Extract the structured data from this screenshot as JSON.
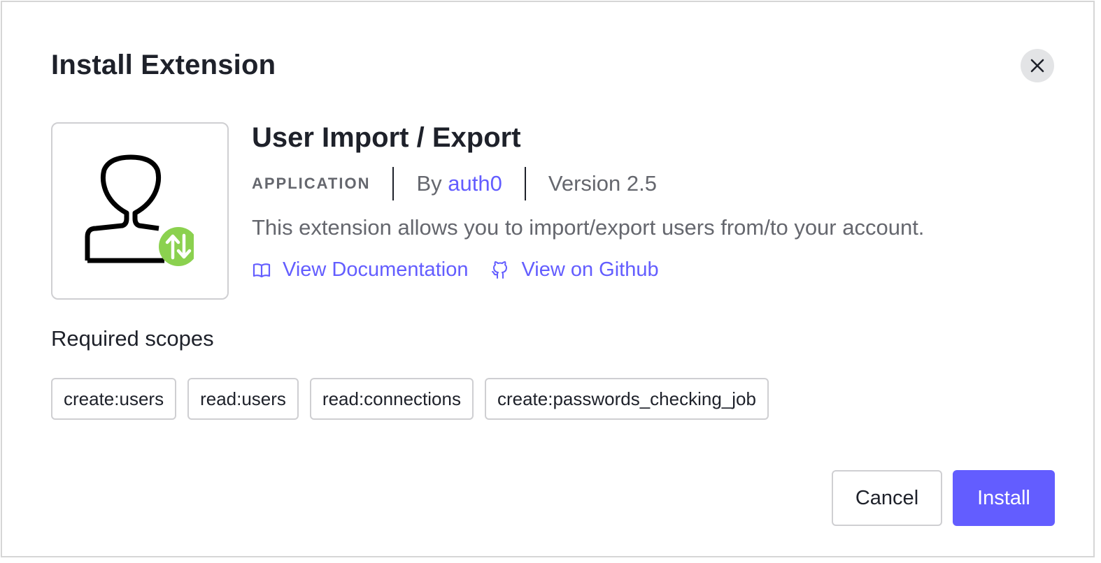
{
  "dialog": {
    "title": "Install Extension",
    "close_icon": "close-icon"
  },
  "extension": {
    "name": "User Import / Export",
    "type": "APPLICATION",
    "by_prefix": "By",
    "author": "auth0",
    "version": "Version 2.5",
    "description": "This extension allows you to import/export users from/to your account.",
    "logo_icon": "user-import-export-icon",
    "accent_color": "#8bd14f",
    "links": {
      "documentation": "View Documentation",
      "documentation_icon": "book-icon",
      "github": "View on Github",
      "github_icon": "github-icon"
    }
  },
  "scopes": {
    "heading": "Required scopes",
    "items": [
      "create:users",
      "read:users",
      "read:connections",
      "create:passwords_checking_job"
    ]
  },
  "actions": {
    "cancel": "Cancel",
    "install": "Install"
  },
  "colors": {
    "primary": "#635dff",
    "text": "#1e212a",
    "muted": "#65676e",
    "border": "#cfcfd2"
  }
}
